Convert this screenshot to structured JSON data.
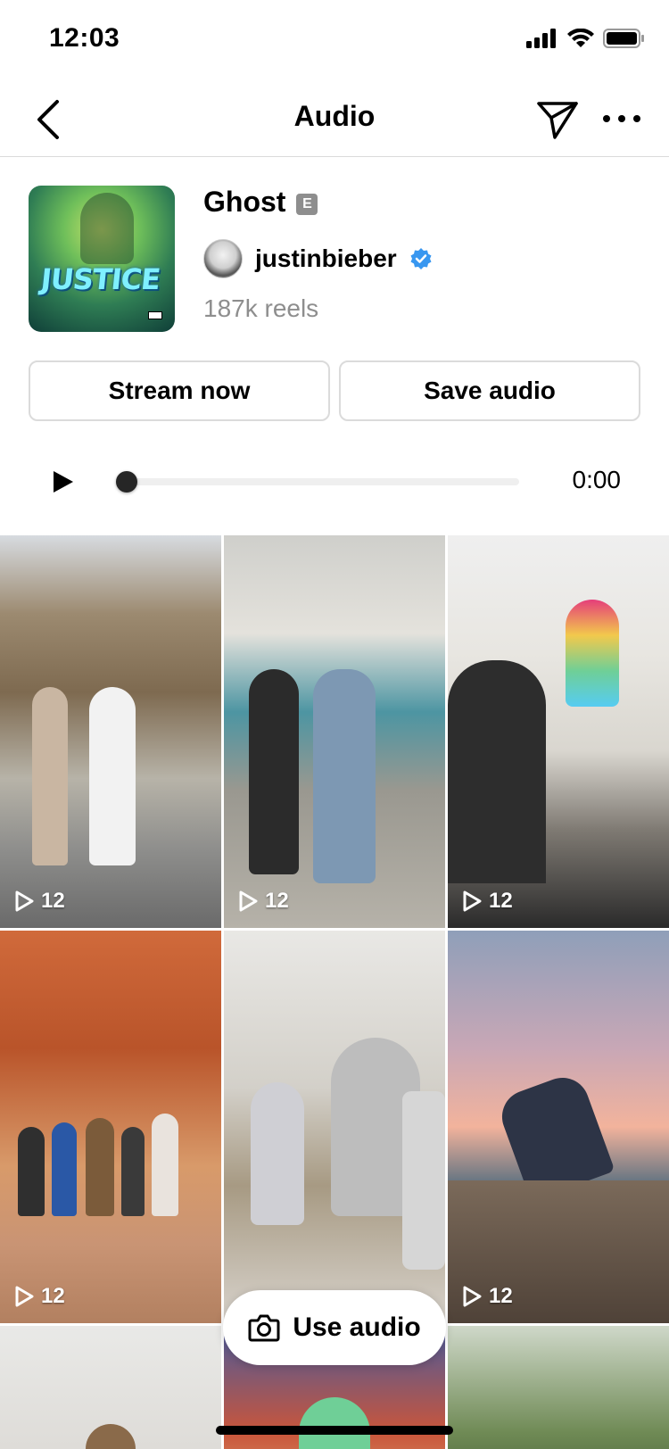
{
  "status_bar": {
    "time": "12:03"
  },
  "nav": {
    "title": "Audio"
  },
  "track": {
    "title": "Ghost",
    "explicit": "E",
    "artist": "justinbieber",
    "reels": "187k reels"
  },
  "buttons": {
    "stream": "Stream now",
    "save": "Save audio"
  },
  "player": {
    "time": "0:00",
    "progress": 0
  },
  "grid": {
    "tiles": [
      {
        "count": "12"
      },
      {
        "count": "12"
      },
      {
        "count": "12"
      },
      {
        "count": "12"
      },
      {
        "count": "12"
      }
    ]
  },
  "use_audio": {
    "label": "Use audio"
  },
  "icons": {
    "back": "chevron-left-icon",
    "share": "paper-plane-icon",
    "more": "more-horizontal-icon",
    "verified": "verified-icon",
    "play": "play-icon",
    "camera": "camera-icon"
  },
  "colors": {
    "verified": "#3897f0",
    "muted": "#8e8e8e",
    "border": "#dbdbdb"
  }
}
